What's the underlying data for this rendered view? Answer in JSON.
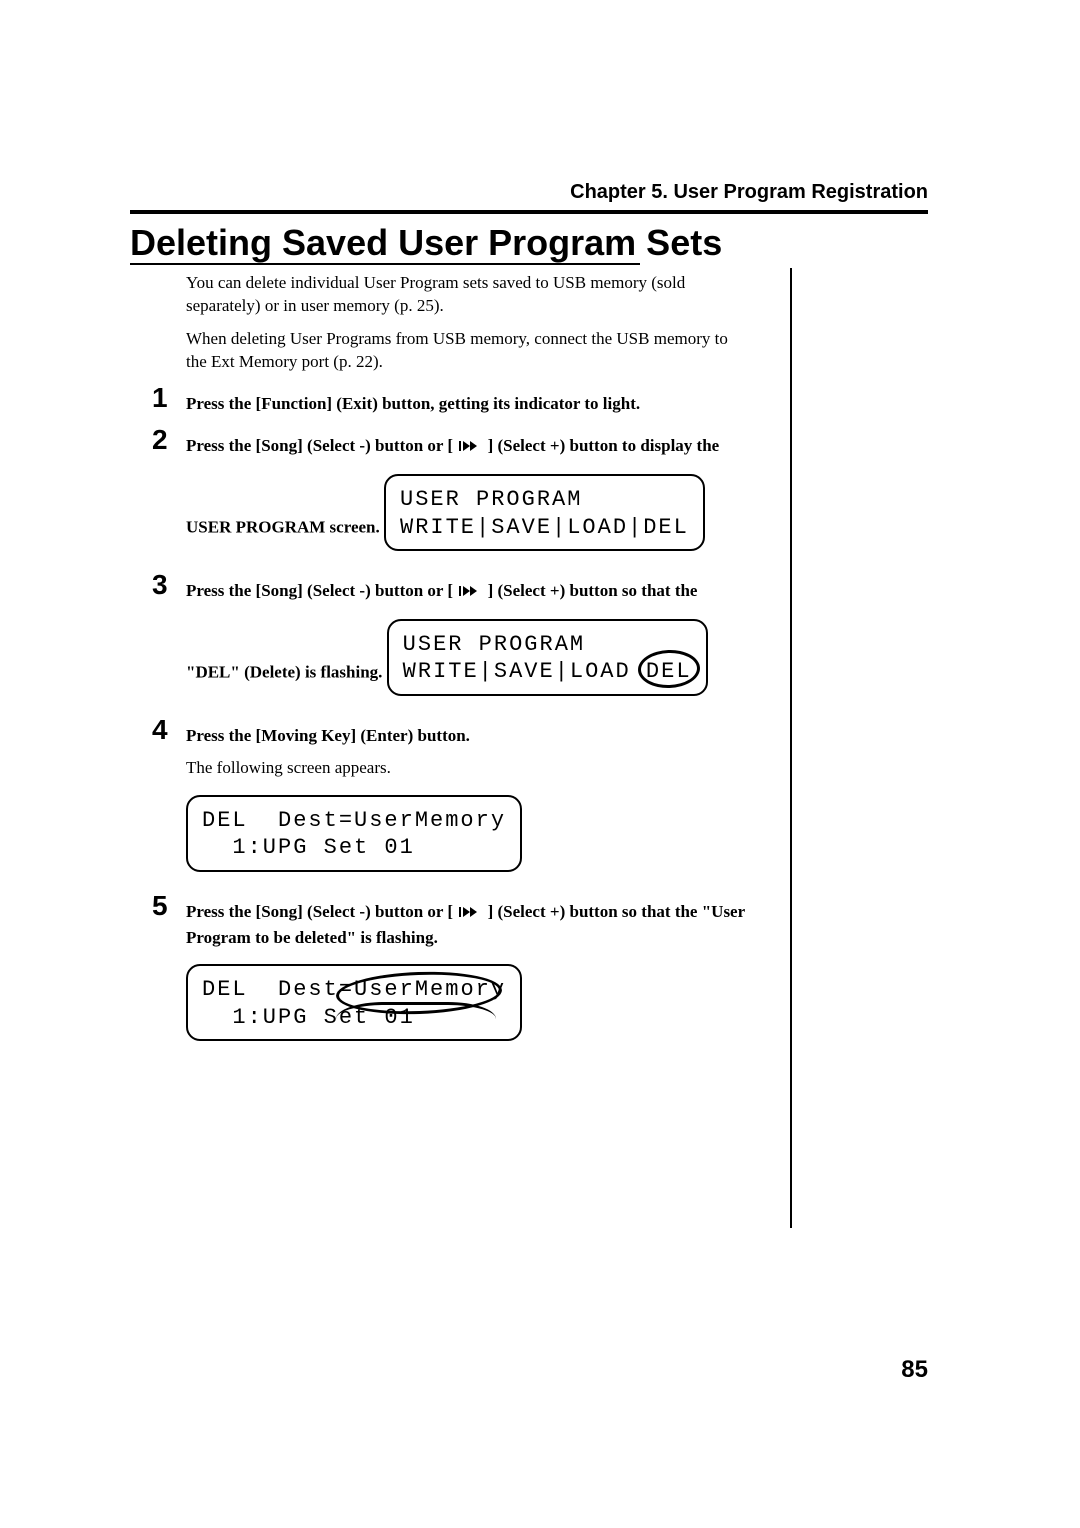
{
  "runningHeader": "Chapter 5. User Program Registration",
  "sectionTitle": "Deleting Saved User Program Sets",
  "intro": {
    "p1": "You can delete individual User Program sets saved to USB memory (sold separately) or in user memory (p. 25).",
    "p2": "When deleting User Programs from USB memory, connect the USB memory to the Ext Memory port (p. 22)."
  },
  "steps": {
    "s1": {
      "num": "1",
      "text": "Press the [Function] (Exit) button, getting its indicator to light."
    },
    "s2": {
      "num": "2",
      "text_a": "Press the [Song] (Select -) button or [ ",
      "text_b": " ] (Select +) button to display the USER PROGRAM screen.",
      "lcd_line1": "USER PROGRAM",
      "lcd_line2": "WRITE|SAVE|LOAD|DEL"
    },
    "s3": {
      "num": "3",
      "text_a": "Press the [Song] (Select -) button or [ ",
      "text_b": " ] (Select +) button so that the \"DEL\" (Delete) is flashing.",
      "lcd_line1": "USER PROGRAM",
      "lcd_line2_a": "WRITE|SAVE|LOAD",
      "lcd_line2_b": "DEL"
    },
    "s4": {
      "num": "4",
      "text": "Press the [Moving Key] (Enter) button.",
      "sub": "The following screen appears.",
      "lcd_line1": "DEL  Dest=UserMemory",
      "lcd_line2": "  1:UPG Set 01"
    },
    "s5": {
      "num": "5",
      "text_a": "Press the [Song] (Select -) button or [ ",
      "text_b": " ] (Select +) button so that the \"User Program to be deleted\" is flashing.",
      "lcd_line1_a": "DEL  Dest=",
      "lcd_line1_b": "UserMemory",
      "lcd_line2": "  1:UPG Set 01"
    }
  },
  "pageNumber": "85"
}
